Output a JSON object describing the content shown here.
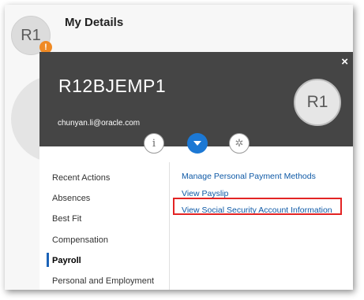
{
  "page": {
    "title": "My Details",
    "avatar_initials": "R1",
    "notification_glyph": "!"
  },
  "popup": {
    "close_glyph": "×",
    "person_code": "R12BJEMP1",
    "email": "chunyan.li@oracle.com",
    "avatar_initials": "R1",
    "tabs": [
      {
        "icon": "info-icon",
        "glyph": "i"
      },
      {
        "icon": "expand-icon",
        "glyph": ""
      },
      {
        "icon": "tools-icon",
        "glyph": "✲"
      }
    ]
  },
  "nav": {
    "items": [
      {
        "label": "Recent Actions"
      },
      {
        "label": "Absences"
      },
      {
        "label": "Best Fit"
      },
      {
        "label": "Compensation"
      },
      {
        "label": "Payroll"
      },
      {
        "label": "Personal and Employment"
      }
    ],
    "active_index": 4
  },
  "links": [
    {
      "label": "Manage Personal Payment Methods"
    },
    {
      "label": "View Payslip"
    },
    {
      "label": "View Social Security Account Information"
    }
  ],
  "colors": {
    "header_bg": "#454545",
    "link": "#0e59a6",
    "accent_blue": "#1c78d4",
    "highlight": "#e32424",
    "badge": "#f08a24"
  }
}
